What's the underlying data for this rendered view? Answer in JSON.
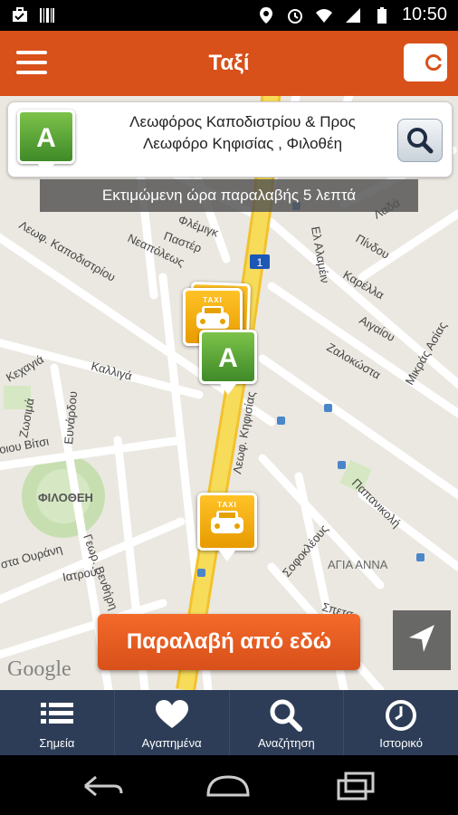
{
  "status_bar": {
    "time": "10:50"
  },
  "app_bar": {
    "title": "Ταξί"
  },
  "address_card": {
    "pin_letter": "A",
    "line1": "Λεωφόρος Καποδιστρίου & Προς",
    "line2": "Λεωφόρο Κηφισίας , Φιλοθέη"
  },
  "eta_banner": "Εκτιμώμενη ώρα παραλαβής 5 λεπτά",
  "map": {
    "pin_letter": "A",
    "taxi_label": "TAXI",
    "road_badge": "1",
    "watermark": "Google",
    "labels": {
      "flemingk": "Φλέμιγκ",
      "neapoleos": "Νεαπόλεως",
      "paster": "Παστέρ",
      "leof_kapodistriou": "Λεωφ. Καποδιστρίου",
      "kaligas": "Καλλιγά",
      "kechagia": "Κεχαγιά",
      "zosima": "Ζωσιμά",
      "evnardou": "Ευνάρδου",
      "viti": "οιου Βίτσι",
      "filothei": "ΦΙΛΟΘΕΗ",
      "el_alamein": "Ελ Αλαμέιν",
      "pindou": "Πίνδου",
      "karella": "Καρέλλα",
      "aigaiou": "Αιγαίου",
      "zalokosta": "Ζαλοκώστα",
      "mikras_asias": "Μικράς Ασίας",
      "leof_kifisias": "Λεωφ. Κηφισίας",
      "papanikoli": "Παπανικολή",
      "sofokleous": "Σοφοκλέους",
      "agia_anna": "ΑΓΙΑ ΑΝΝΑ",
      "ourani": "στα Ουράνη",
      "iatrou": "Ιατρού",
      "georg_venthiri": "Γεωρ. Βενθήρη",
      "spetson": "Σπετσ",
      "lada": "Λαδά"
    }
  },
  "pickup_button": "Παραλαβή από εδώ",
  "tabs": [
    {
      "label": "Σημεία",
      "icon": "list-icon"
    },
    {
      "label": "Αγαπημένα",
      "icon": "heart-icon"
    },
    {
      "label": "Αναζήτηση",
      "icon": "search-icon"
    },
    {
      "label": "Ιστορικό",
      "icon": "clock-icon"
    }
  ]
}
